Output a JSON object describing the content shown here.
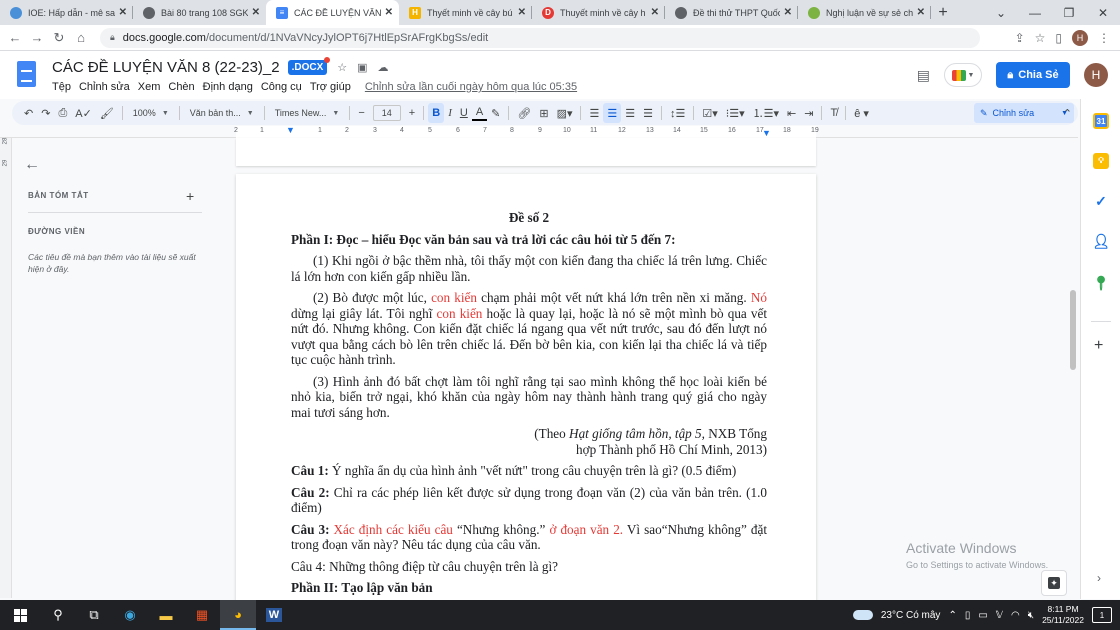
{
  "browser": {
    "tabs": [
      {
        "title": "IOE: Hấp dẫn - mê sa",
        "icon": "ioe-icon",
        "color": "#4a90d9",
        "active": false
      },
      {
        "title": "Bài 80 trang 108 SGK",
        "icon": "globe-icon",
        "color": "#5f6368",
        "active": false
      },
      {
        "title": "CÁC ĐỀ LUYỆN VĂN 8",
        "icon": "docs-icon",
        "color": "#4285f4",
        "active": true
      },
      {
        "title": "Thyết minh về cây bú",
        "icon": "hoc247-icon",
        "color": "#f4b400",
        "active": false
      },
      {
        "title": "Thuyết minh về cây h",
        "icon": "doctailieu-icon",
        "color": "#e53935",
        "active": false
      },
      {
        "title": "Đề thi thử THPT Quốc",
        "icon": "globe-icon",
        "color": "#5f6368",
        "active": false
      },
      {
        "title": "Nghị luận về sự sẻ ch",
        "icon": "frog-icon",
        "color": "#7cb342",
        "active": false
      }
    ],
    "new_tab": "+",
    "url_domain": "docs.google.com",
    "url_path": "/document/d/1NVaVNcyJylOPT6j7HtlEpSrAFrgKbgSs/edit",
    "profile_initial": "H"
  },
  "docs": {
    "title": "CÁC ĐỀ LUYỆN VĂN 8 (22-23)_2",
    "badge": ".DOCX",
    "menu": [
      "Tệp",
      "Chỉnh sửa",
      "Xem",
      "Chèn",
      "Định dạng",
      "Công cụ",
      "Trợ giúp"
    ],
    "last_edit": "Chỉnh sửa lần cuối ngày hôm qua lúc 05:35",
    "share_label": "Chia Sẻ",
    "avatar_initial": "H",
    "accent": "#1a73e8"
  },
  "toolbar": {
    "zoom": "100%",
    "style": "Văn bản th...",
    "font": "Times New...",
    "font_size": "14",
    "mode": "Chỉnh sửa"
  },
  "ruler": [
    "2",
    "1",
    "1",
    "2",
    "3",
    "4",
    "5",
    "6",
    "7",
    "8",
    "9",
    "10",
    "11",
    "12",
    "13",
    "14",
    "15",
    "16",
    "17",
    "18",
    "19"
  ],
  "vruler": [
    "28",
    "29"
  ],
  "outline": {
    "summary_label": "BẢN TÓM TẮT",
    "outline_label": "ĐƯỜNG VIỀN",
    "hint": "Các tiêu đề mà bạn thêm vào tài liệu sẽ xuất hiện ở đây."
  },
  "document": {
    "heading": "Đề số 2",
    "part1": "Phần I: Đọc – hiểu Đọc văn bản sau và trả lời các câu hỏi từ 5 đến 7:",
    "p1": "(1) Khi ngồi ở bậc thềm nhà, tôi thấy một con kiến đang tha chiếc lá trên lưng. Chiếc lá lớn hơn con kiến gấp nhiều lần.",
    "p2_a": "(2) Bò được một lúc, ",
    "p2_red1": "con kiến",
    "p2_b": " chạm phải một vết nứt khá lớn trên nền xi măng. ",
    "p2_red2": "Nó",
    "p2_c": " dừng lại giây lát. Tôi nghĩ ",
    "p2_red3": "con kiến",
    "p2_d": " hoặc là quay lại, hoặc là nó sẽ một mình bò qua vết nứt đó. Nhưng không. Con kiến đặt chiếc lá ngang qua vết nứt trước, sau đó đến lượt nó vượt qua bằng cách bò lên trên chiếc lá. Đến bờ bên kia, con kiến lại tha chiếc lá và tiếp tục cuộc hành trình.",
    "p3": "(3) Hình ảnh đó bất chợt làm tôi nghĩ rằng tại sao mình không thể học loài kiến bé nhỏ kia, biến trở ngại, khó khăn của ngày hôm nay thành hành trang quý giá cho ngày mai tươi sáng hơn.",
    "source_a": "(Theo ",
    "source_italic": "Hạt giống tâm hồn, tập 5,",
    "source_b": " NXB Tổng",
    "source_line2": "hợp Thành phố Hồ Chí Minh, 2013)",
    "q1_label": "Câu 1:",
    "q1": " Ý nghĩa ẩn dụ của hình ảnh \"vết nứt\" trong câu chuyện trên là gì? (0.5 điểm)",
    "q2_label": "Câu 2:",
    "q2": " Chỉ ra các phép liên kết được sử dụng trong đoạn văn (2) của văn bản trên. (1.0 điểm)",
    "q3_label": "Câu 3:",
    "q3_red1": " Xác định các kiểu câu",
    "q3_a": " “Nhưng không.” ",
    "q3_red2": "ở đoạn văn 2.",
    "q3_b": " Vì sao“Nhưng không” đặt trong đoạn văn này? Nêu tác dụng của câu văn.",
    "q4": "Câu 4: Những thông điệp từ câu chuyện trên là gì?",
    "part2": "Phần II: Tạo lập văn bản",
    "highlight_color": "#e53935"
  },
  "watermark": {
    "title": "Activate Windows",
    "subtitle": "Go to Settings to activate Windows."
  },
  "taskbar": {
    "weather": "23°C  Có mây",
    "time": "8:11 PM",
    "date": "25/11/2022",
    "notifications": "1"
  }
}
